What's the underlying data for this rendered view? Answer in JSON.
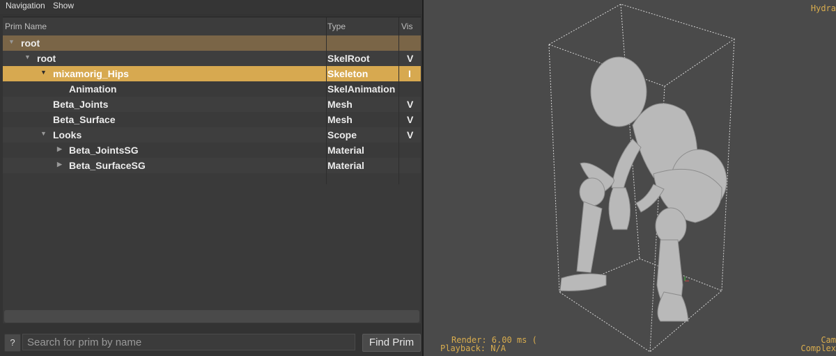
{
  "menu": {
    "navigation": "Navigation",
    "show": "Show"
  },
  "tree": {
    "headers": {
      "name": "Prim Name",
      "type": "Type",
      "vis": "Vis"
    },
    "rows": [
      {
        "name": "root",
        "type": "",
        "vis": "",
        "expanded": true
      },
      {
        "name": "root",
        "type": "SkelRoot",
        "vis": "V",
        "expanded": true
      },
      {
        "name": "mixamorig_Hips",
        "type": "Skeleton",
        "vis": "I",
        "expanded": true,
        "selected": true
      },
      {
        "name": "Animation",
        "type": "SkelAnimation",
        "vis": ""
      },
      {
        "name": "Beta_Joints",
        "type": "Mesh",
        "vis": "V"
      },
      {
        "name": "Beta_Surface",
        "type": "Mesh",
        "vis": "V"
      },
      {
        "name": "Looks",
        "type": "Scope",
        "vis": "V",
        "expanded": true
      },
      {
        "name": "Beta_JointsSG",
        "type": "Material",
        "vis": "",
        "expanded": false
      },
      {
        "name": "Beta_SurfaceSG",
        "type": "Material",
        "vis": "",
        "expanded": false
      }
    ]
  },
  "search": {
    "help_label": "?",
    "placeholder": "Search for prim by name",
    "find_label": "Find Prim"
  },
  "viewport": {
    "hud_top_right": "Hydra",
    "hud_render": "Render: 6.00 ms (",
    "hud_playback": "Playback: N/A",
    "hud_cam": "Cam",
    "hud_complexity": "Complex"
  },
  "colors": {
    "selected_row": "#d7a950",
    "root_row": "#7a6547",
    "hud": "#d9ad4e",
    "viewport_bg": "#4a4a4a"
  }
}
